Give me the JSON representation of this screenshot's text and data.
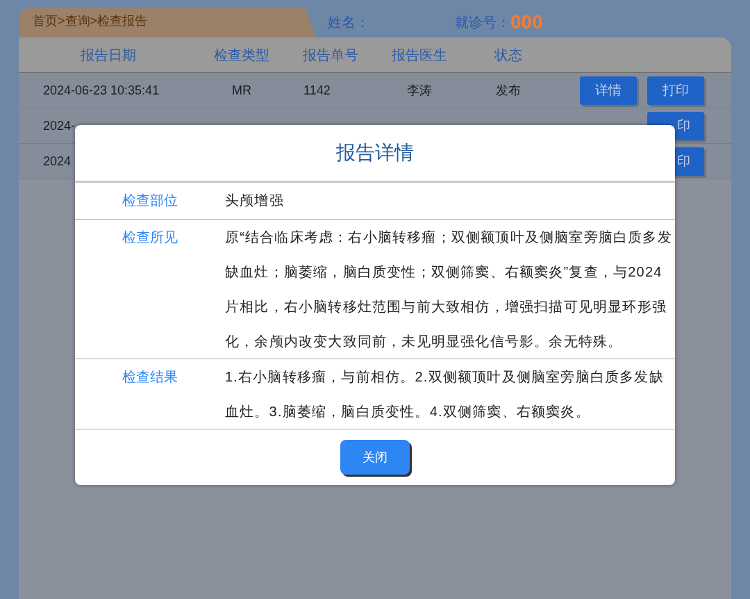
{
  "breadcrumb": "首页>查询>检查报告",
  "patient": {
    "name_label": "姓名：",
    "visit_label": "就诊号：",
    "visit_number": "000"
  },
  "table": {
    "columns": [
      "报告日期",
      "检查类型",
      "报告单号",
      "报告医生",
      "状态"
    ],
    "rows": [
      {
        "date": "2024-06-23 10:35:41",
        "type": "MR",
        "number": "1142",
        "doctor": "李涛",
        "status": "发布",
        "buttons": [
          "详情",
          "打印"
        ]
      },
      {
        "date": "2024-",
        "buttons": [
          "印"
        ]
      },
      {
        "date": "2024",
        "buttons": [
          "印"
        ]
      }
    ]
  },
  "dialog": {
    "title": "报告详情",
    "fields": [
      {
        "label": "检查部位",
        "value": "头颅增强"
      },
      {
        "label": "检查所见",
        "value": "原“结合临床考虑：右小脑转移瘤；双侧额顶叶及侧脑室旁脑白质多发缺血灶；脑萎缩，脑白质变性；双侧筛窦、右额窦炎”复查，与2024        片相比，右小脑转移灶范围与前大致相仿，增强扫描可见明显环形强化，余颅内改变大致同前，未见明显强化信号影。余无特殊。"
      },
      {
        "label": "检查结果",
        "value": "1.右小脑转移瘤，与前相仿。2.双侧额顶叶及侧脑室旁脑白质多发缺血灶。3.脑萎缩，脑白质变性。4.双侧筛窦、右额窦炎。"
      }
    ],
    "close_button": "关闭"
  }
}
